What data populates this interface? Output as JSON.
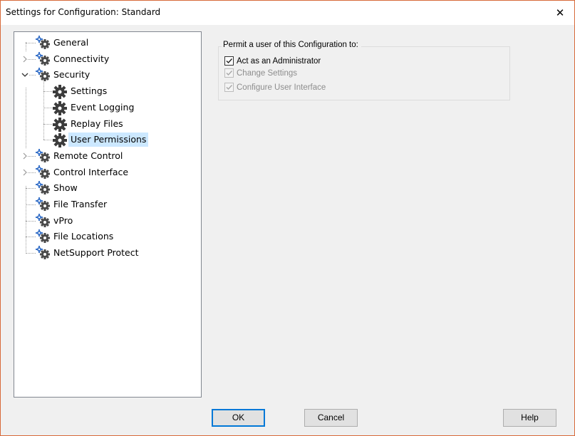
{
  "window": {
    "title": "Settings for Configuration: Standard",
    "close_glyph": "✕"
  },
  "tree": {
    "items": [
      {
        "label": "General",
        "level": 0,
        "expander": "",
        "selected": false
      },
      {
        "label": "Connectivity",
        "level": 0,
        "expander": ">",
        "selected": false
      },
      {
        "label": "Security",
        "level": 0,
        "expander": "v",
        "selected": false
      },
      {
        "label": "Settings",
        "level": 1,
        "expander": "",
        "selected": false
      },
      {
        "label": "Event Logging",
        "level": 1,
        "expander": "",
        "selected": false
      },
      {
        "label": "Replay Files",
        "level": 1,
        "expander": "",
        "selected": false
      },
      {
        "label": "User Permissions",
        "level": 1,
        "expander": "",
        "selected": true
      },
      {
        "label": "Remote Control",
        "level": 0,
        "expander": ">",
        "selected": false
      },
      {
        "label": "Control Interface",
        "level": 0,
        "expander": ">",
        "selected": false
      },
      {
        "label": "Show",
        "level": 0,
        "expander": "",
        "selected": false
      },
      {
        "label": "File Transfer",
        "level": 0,
        "expander": "",
        "selected": false
      },
      {
        "label": "vPro",
        "level": 0,
        "expander": "",
        "selected": false
      },
      {
        "label": "File Locations",
        "level": 0,
        "expander": "",
        "selected": false
      },
      {
        "label": "NetSupport Protect",
        "level": 0,
        "expander": "",
        "selected": false
      }
    ]
  },
  "permissions": {
    "group_label": "Permit a user of this Configuration to:",
    "options": [
      {
        "label": "Act as an Administrator",
        "checked": true,
        "enabled": true
      },
      {
        "label": "Change Settings",
        "checked": true,
        "enabled": false
      },
      {
        "label": "Configure User Interface",
        "checked": true,
        "enabled": false
      }
    ]
  },
  "buttons": {
    "ok": "OK",
    "cancel": "Cancel",
    "help": "Help"
  },
  "icons": {
    "tree_item": "gears-icon",
    "tree_child": "gear-icon"
  },
  "colors": {
    "selection": "#cce8ff",
    "window_border": "#d86a3a",
    "default_button_border": "#0078d7"
  }
}
